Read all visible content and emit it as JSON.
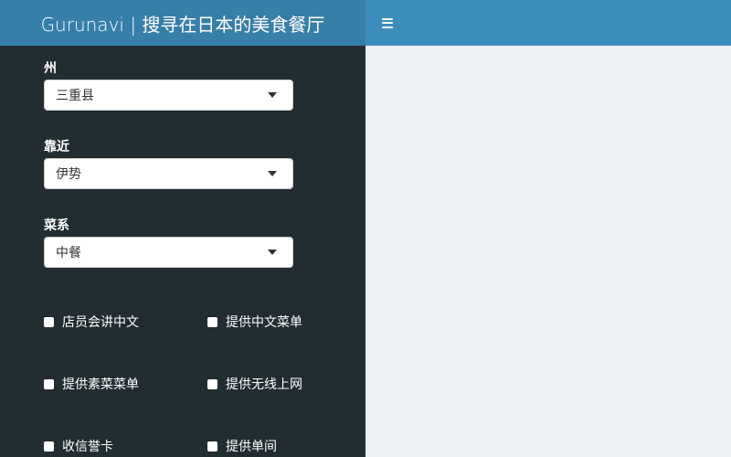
{
  "header": {
    "brand": "Gurunavi | 搜寻在日本的美食餐厅"
  },
  "filters": {
    "state": {
      "label": "州",
      "value": "三重县"
    },
    "near": {
      "label": "靠近",
      "value": "伊势"
    },
    "cuisine": {
      "label": "菜系",
      "value": "中餐"
    }
  },
  "checkboxes": [
    {
      "label": "店员会讲中文",
      "checked": false
    },
    {
      "label": "提供中文菜单",
      "checked": false
    },
    {
      "label": "提供素菜菜单",
      "checked": false
    },
    {
      "label": "提供无线上网",
      "checked": false
    },
    {
      "label": "收信誉卡",
      "checked": false
    },
    {
      "label": "提供单间",
      "checked": false
    }
  ],
  "icons": {
    "sidebar_toggle": "hamburger-menu-icon",
    "select_caret": "caret-down-icon"
  },
  "colors": {
    "brand_bg": "#367fa9",
    "navbar_bg": "#3c8dbc",
    "sidebar_bg": "#222d32",
    "content_bg": "#ecf0f5"
  }
}
